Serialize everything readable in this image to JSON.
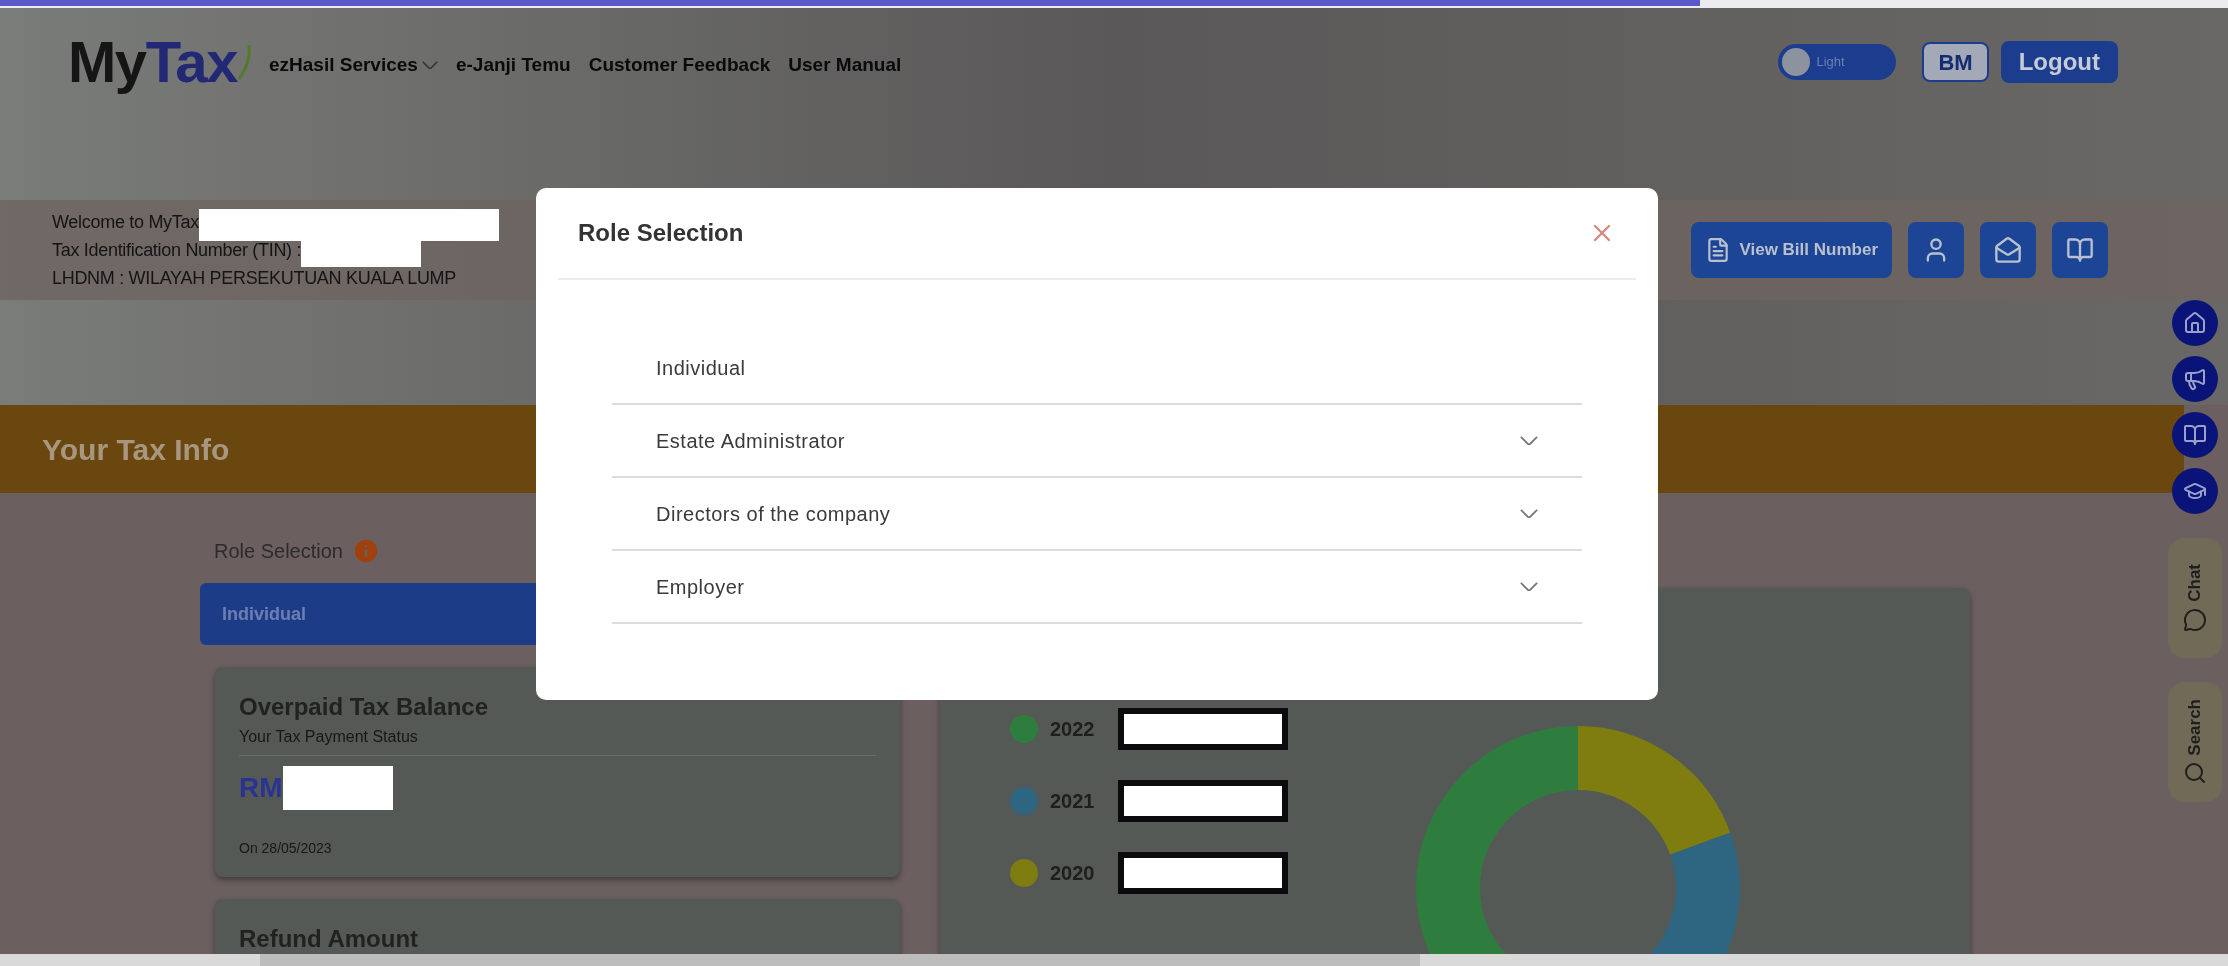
{
  "logo": [
    "My",
    "Tax"
  ],
  "nav": [
    {
      "label": "ezHasil Services",
      "kind": "dropdown"
    },
    {
      "label": "e-Janji Temu",
      "kind": "link"
    },
    {
      "label": "Customer Feedback",
      "kind": "link"
    },
    {
      "label": "User Manual",
      "kind": "link"
    }
  ],
  "theme_toggle": {
    "label": "Light",
    "on": false
  },
  "language_button": "BM",
  "logout_button": "Logout",
  "welcome": [
    {
      "text": "Welcome to MyTax",
      "redacted": true
    },
    {
      "text": "Tax Identification Number (TIN) :",
      "redacted": true
    },
    {
      "text": "LHDNM : WILAYAH PERSEKUTUAN KUALA LUMP",
      "redacted": false
    }
  ],
  "view_bill_button": "View Bill Number",
  "section_title": "Your Tax Info",
  "role_selection": {
    "label": "Role Selection",
    "selected_role": "Individual"
  },
  "cards": [
    {
      "title": "Overpaid Tax Balance",
      "subtitle": "Your Tax Payment Status",
      "amount_prefix": "RM",
      "date": "On 28/05/2023"
    },
    {
      "title": "Refund Amount"
    }
  ],
  "legend": [
    {
      "year": "2022",
      "color": "#2e7d3e"
    },
    {
      "year": "2021",
      "color": "#2e6580"
    },
    {
      "year": "2020",
      "color": "#7f7d10"
    }
  ],
  "side_tabs": [
    {
      "label": "Chat",
      "kind": "chat"
    },
    {
      "label": "Search",
      "kind": "search"
    }
  ],
  "modal": {
    "title": "Role Selection",
    "items": [
      {
        "label": "Individual",
        "kind": "plain"
      },
      {
        "label": "Estate Administrator",
        "kind": "expandable"
      },
      {
        "label": "Directors of the company",
        "kind": "expandable"
      },
      {
        "label": "Employer",
        "kind": "expandable"
      }
    ]
  }
}
